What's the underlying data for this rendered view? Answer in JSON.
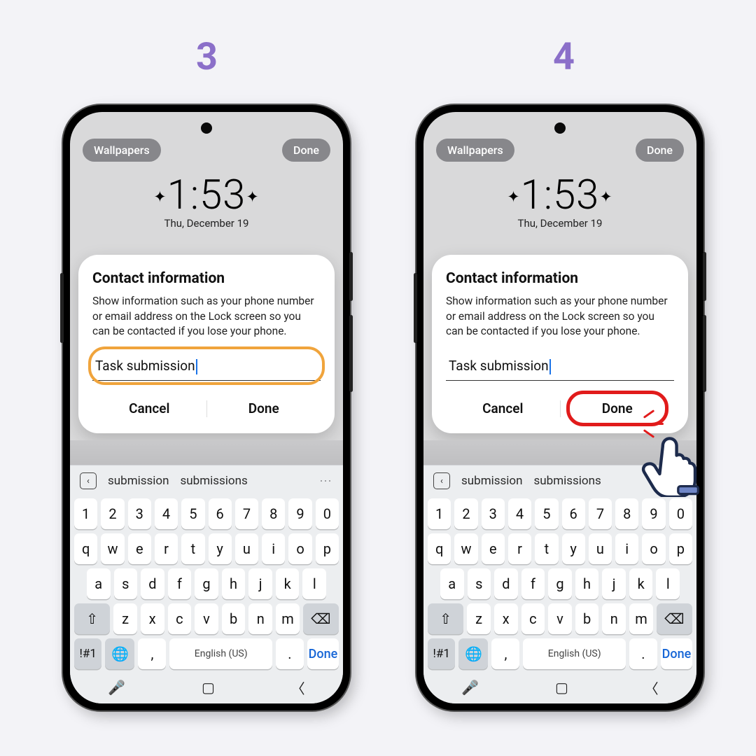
{
  "steps": {
    "s3": "3",
    "s4": "4"
  },
  "colors": {
    "accent_step": "#8b6fc9",
    "hl_input": "#f0a43c",
    "hl_done": "#e11b1b",
    "kb_done": "#1766d6"
  },
  "phone": {
    "top": {
      "wallpapers": "Wallpapers",
      "done": "Done"
    },
    "clock": {
      "time": "1:53",
      "date": "Thu, December 19"
    },
    "dialog": {
      "title": "Contact information",
      "body": "Show information such as your phone number or email address on the Lock screen so you can be contacted if you lose your phone.",
      "input_value": "Task submission",
      "cancel": "Cancel",
      "done": "Done"
    },
    "keyboard": {
      "suggestions": [
        "submission",
        "submissions"
      ],
      "row_num": [
        "1",
        "2",
        "3",
        "4",
        "5",
        "6",
        "7",
        "8",
        "9",
        "0"
      ],
      "row_q": [
        "q",
        "w",
        "e",
        "r",
        "t",
        "y",
        "u",
        "i",
        "o",
        "p"
      ],
      "row_a": [
        "a",
        "s",
        "d",
        "f",
        "g",
        "h",
        "j",
        "k",
        "l"
      ],
      "row_z": [
        "z",
        "x",
        "c",
        "v",
        "b",
        "n",
        "m"
      ],
      "sym": "!#1",
      "space": "English (US)",
      "comma": ",",
      "period": ".",
      "done": "Done"
    }
  }
}
